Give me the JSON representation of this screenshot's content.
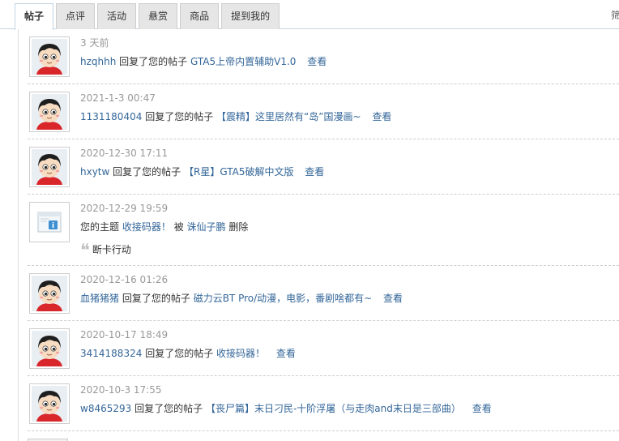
{
  "tabs": [
    {
      "label": "帖子",
      "active": true
    },
    {
      "label": "点评",
      "active": false
    },
    {
      "label": "活动",
      "active": false
    },
    {
      "label": "悬赏",
      "active": false
    },
    {
      "label": "商品",
      "active": false
    },
    {
      "label": "提到我的",
      "active": false
    }
  ],
  "right_edge_text": "筛",
  "view_label": "查看",
  "items": [
    {
      "time": "3 天前",
      "user": "hzqhhh",
      "action": "回复了您的帖子",
      "subject": "GTA5上帝内置辅助V1.0",
      "view": "查看"
    },
    {
      "time": "2021-1-3 00:47",
      "user": "1131180404",
      "action": "回复了您的帖子",
      "subject": "【震精】这里居然有“岛”国漫画~",
      "view": "查看"
    },
    {
      "time": "2020-12-30 17:11",
      "user": "hxytw",
      "action": "回复了您的帖子",
      "subject": "【R星】GTA5破解中文版",
      "view": "查看"
    },
    {
      "time": "2020-12-29 19:59",
      "prefix": "您的主题",
      "subject": "收接码器！",
      "by": "被",
      "user": "诛仙子鹏",
      "action": "删除",
      "quote": "断卡行动",
      "is_notice": true
    },
    {
      "time": "2020-12-16 01:26",
      "user": "血猪猪猪",
      "action": "回复了您的帖子",
      "subject": "磁力云BT Pro/动漫，电影，番剧啥都有~",
      "view": "查看"
    },
    {
      "time": "2020-10-17 18:49",
      "user": "3414188324",
      "action": "回复了您的帖子",
      "subject": "收接码器！",
      "view": "查看"
    },
    {
      "time": "2020-10-3 17:55",
      "user": "w8465293",
      "action": "回复了您的帖子",
      "subject": "【丧尸篇】末日刁民-十阶浮屠（与走肉and末日是三部曲）",
      "view": "查看"
    }
  ]
}
